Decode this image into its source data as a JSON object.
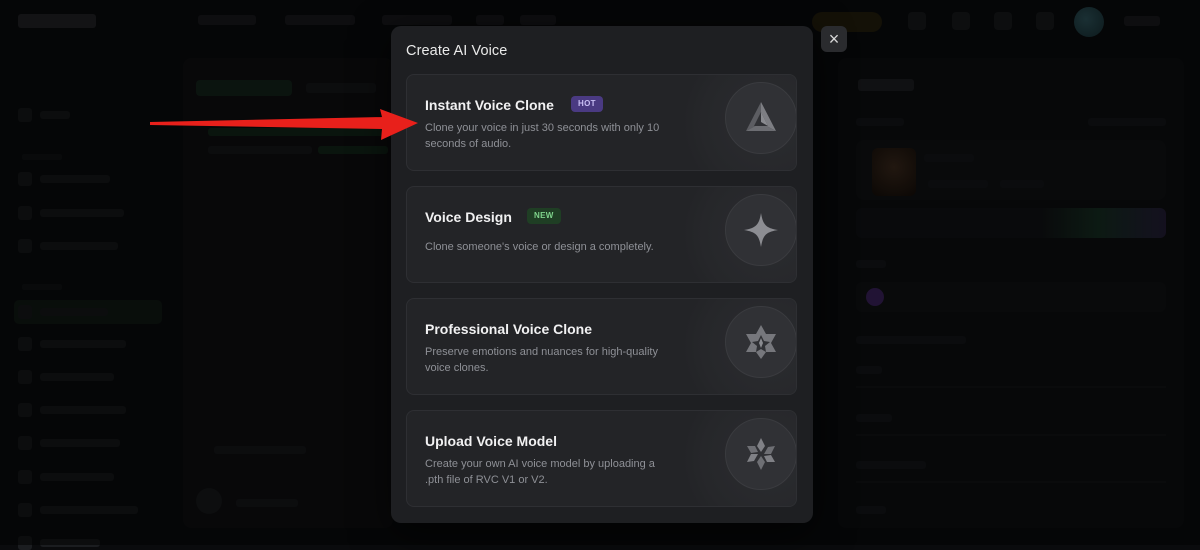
{
  "modal": {
    "title": "Create AI Voice",
    "close_label": "×",
    "options": [
      {
        "title": "Instant Voice Clone",
        "badge": "HOT",
        "description": "Clone your voice in just 30 seconds with only 10 seconds of audio.",
        "icon": "triangle-logo-icon"
      },
      {
        "title": "Voice Design",
        "badge": "NEW",
        "description": "Clone someone's voice or design a completely.",
        "icon": "sparkle-star-icon"
      },
      {
        "title": "Professional Voice Clone",
        "badge": "",
        "description": "Preserve emotions and nuances for high-quality voice clones.",
        "icon": "star-badge-icon"
      },
      {
        "title": "Upload Voice Model",
        "badge": "",
        "description": "Create your own AI voice model by uploading a .pth file of RVC V1 or V2.",
        "icon": "hexagon-petals-icon"
      }
    ]
  },
  "annotation": {
    "arrow_color": "#e8201b"
  },
  "colors": {
    "hot_badge_bg": "#4a3a82",
    "new_badge_bg": "#1f3e24",
    "modal_bg": "#1e1f22"
  }
}
